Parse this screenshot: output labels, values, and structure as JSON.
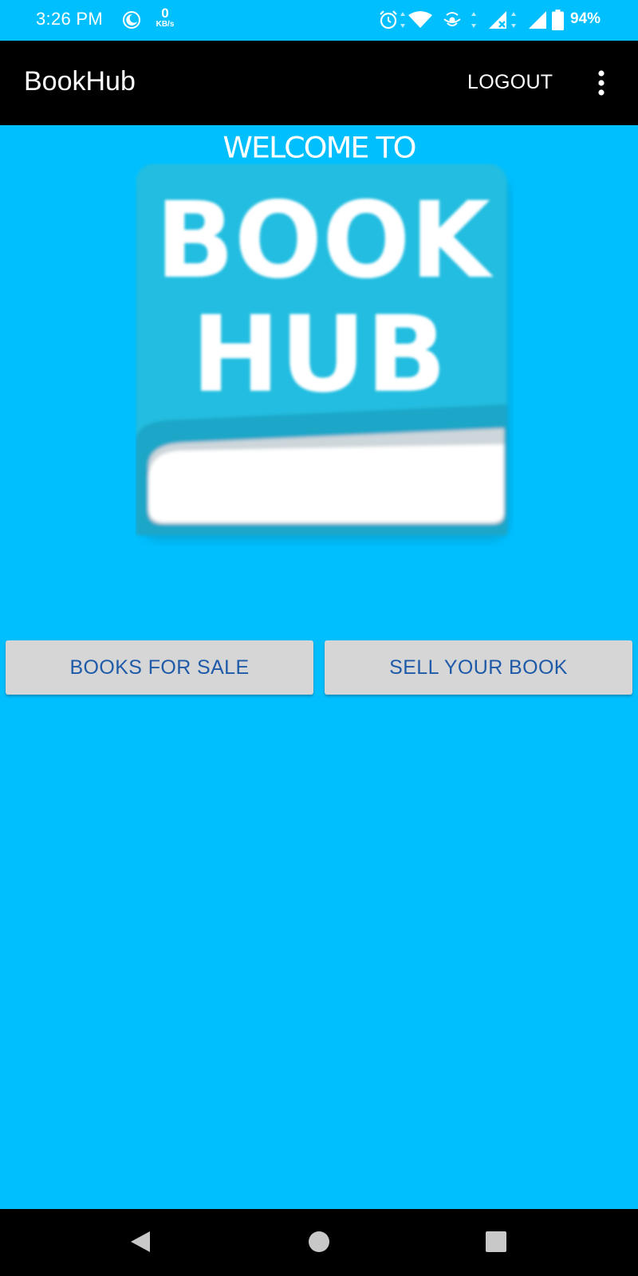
{
  "status_bar": {
    "time": "3:26 PM",
    "net_speed_value": "0",
    "net_speed_unit": "KB/s",
    "battery": "94%",
    "icons": [
      "moon-icon",
      "alarm-icon",
      "wifi-icon",
      "hotspot-icon",
      "signal-icon",
      "signal-icon",
      "battery-icon"
    ]
  },
  "app_bar": {
    "title": "BookHub",
    "logout": "LOGOUT",
    "menu_icon": "more-vert-icon"
  },
  "main": {
    "welcome": "WELCOME TO",
    "logo_line1": "BOOK",
    "logo_line2": "HUB",
    "books_for_sale": "BOOKS FOR SALE",
    "sell_your_book": "SELL YOUR BOOK"
  },
  "nav_bar": {
    "icons": [
      "back-icon",
      "home-icon",
      "recents-icon"
    ]
  },
  "colors": {
    "background": "#00bfff",
    "app_bar": "#000000",
    "button": "#d6d6d6",
    "button_text": "#1e5aa8",
    "logo_cover": "#23bde0"
  }
}
